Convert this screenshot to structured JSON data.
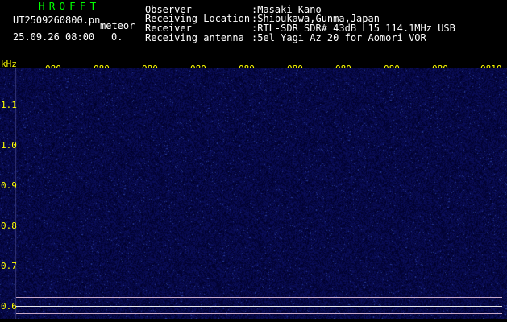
{
  "header": {
    "software_name": "HROFFT",
    "filename": "UT2509260800.pn",
    "mode": "meteor",
    "datetime": "25.09.26 08:00",
    "count": "0."
  },
  "info": {
    "observer_label": "Observer",
    "observer_value": ":Masaki Kano",
    "location_label": "Receiving Location",
    "location_value": ":Shibukawa,Gunma,Japan",
    "receiver_label": "Receiver",
    "receiver_value": ":RTL-SDR SDR# 43dB L15 114.1MHz USB",
    "antenna_label": "Receiving antenna",
    "antenna_value": ":5el Yagi Az 20 for Aomori VOR"
  },
  "time_axis": {
    "labels": [
      "080",
      "080",
      "080",
      "080",
      "080",
      "080",
      "080",
      "080",
      "080",
      "0810"
    ]
  },
  "freq_axis": {
    "unit": "kHz",
    "labels": [
      "1.1",
      "1.0",
      "0.9",
      "0.8",
      "0.7",
      "0.6"
    ]
  },
  "colors": {
    "background": "#000000",
    "waterfall_base": "#06063a",
    "title_green": "#00ff00",
    "label_yellow": "#ffff00",
    "text_white": "#ffffff",
    "trace_cyan": "#00e5ff",
    "divider_pink": "#c8a8c8",
    "divider_white": "#e8e8e8"
  }
}
